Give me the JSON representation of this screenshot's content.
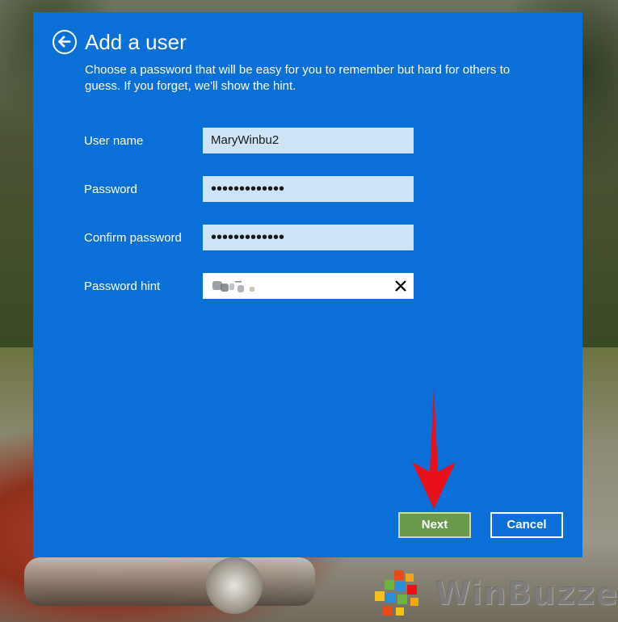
{
  "dialog": {
    "title": "Add a user",
    "description": "Choose a password that will be easy for you to remember but hard for others to guess. If you forget, we'll show the hint.",
    "fields": {
      "username": {
        "label": "User name",
        "value": "MaryWinbu2"
      },
      "password": {
        "label": "Password",
        "value": "•••••••••••••"
      },
      "confirm": {
        "label": "Confirm password",
        "value": "•••••••••••••"
      },
      "hint": {
        "label": "Password hint",
        "value": ""
      }
    },
    "buttons": {
      "next": "Next",
      "cancel": "Cancel"
    }
  },
  "watermark": {
    "text": "WinBuzzer"
  },
  "colors": {
    "dialog_bg": "#0a6fd6",
    "field_bg": "#cde3f6",
    "next_bg": "#6b9a4c",
    "arrow": "#e8101a"
  },
  "icons": {
    "back": "back-arrow-circle-icon",
    "clear": "close-icon",
    "annotation": "red-down-arrow-icon"
  }
}
